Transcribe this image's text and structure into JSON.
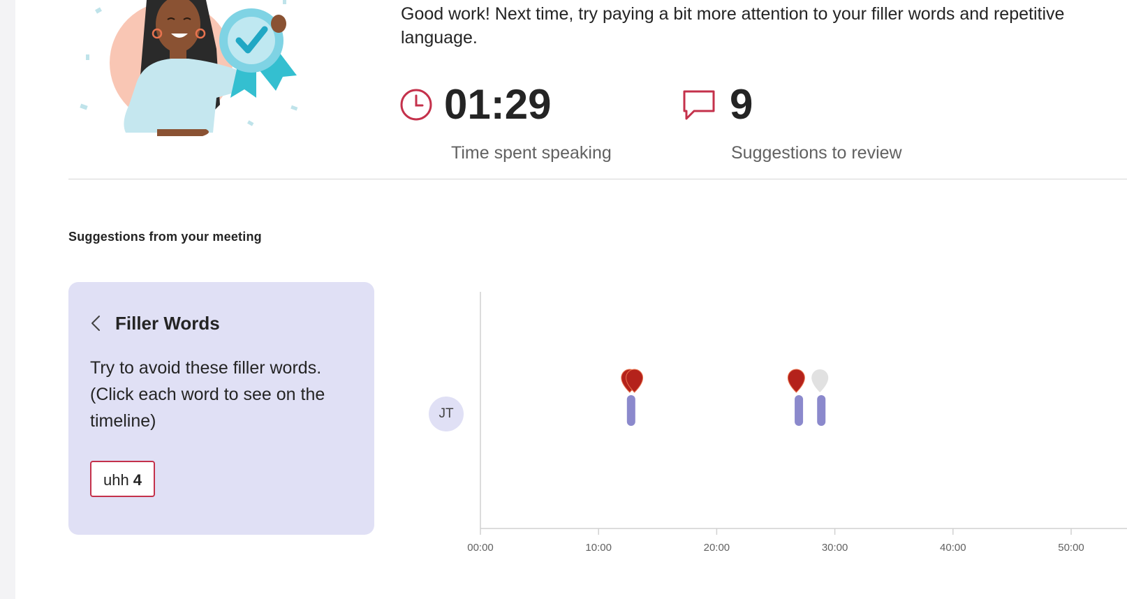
{
  "summary": {
    "message": "Good work! Next time, try paying a bit more attention to your filler words and repetitive language."
  },
  "stats": [
    {
      "icon": "clock-icon",
      "value": "01:29",
      "label": "Time spent speaking"
    },
    {
      "icon": "speech-bubble-icon",
      "value": "9",
      "label": "Suggestions to review"
    }
  ],
  "section": {
    "title": "Suggestions from your meeting"
  },
  "card": {
    "back_icon": "chevron-left-icon",
    "title": "Filler Words",
    "description": "Try to avoid these filler words. (Click each word to see on the timeline)",
    "words": [
      {
        "word": "uhh",
        "count": "4"
      }
    ]
  },
  "timeline": {
    "speaker_initials": "JT",
    "ticks": [
      "00:00",
      "10:00",
      "20:00",
      "30:00",
      "40:00",
      "50:00"
    ],
    "axis_max_minutes": 50,
    "segments": [
      {
        "start_min": 12.4,
        "end_min": 12.9
      },
      {
        "start_min": 26.6,
        "end_min": 26.9
      },
      {
        "start_min": 28.5,
        "end_min": 28.9
      }
    ],
    "markers": [
      {
        "time_min": 12.4,
        "state": "active"
      },
      {
        "time_min": 12.8,
        "state": "active"
      },
      {
        "time_min": 26.5,
        "state": "active"
      },
      {
        "time_min": 28.5,
        "state": "inactive"
      }
    ]
  },
  "colors": {
    "accent": "#c4314b",
    "marker_active": "#b4221b",
    "marker_inactive": "#e1e1e1",
    "segment": "#8b89cc",
    "card_bg": "#e0e0f5",
    "icon_red": "#c4314b"
  }
}
